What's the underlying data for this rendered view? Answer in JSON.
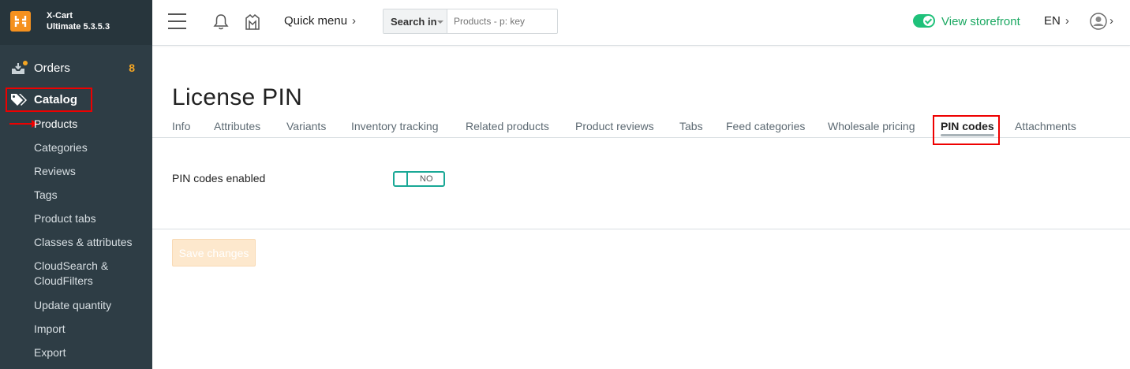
{
  "brand": {
    "name_line1": "X-Cart",
    "name_line2": "Ultimate 5.3.5.3"
  },
  "sidebar": {
    "orders": {
      "label": "Orders",
      "count": "8"
    },
    "catalog": {
      "label": "Catalog"
    },
    "catalog_items": [
      {
        "label": "Products"
      },
      {
        "label": "Categories"
      },
      {
        "label": "Reviews"
      },
      {
        "label": "Tags"
      },
      {
        "label": "Product tabs"
      },
      {
        "label": "Classes & attributes"
      },
      {
        "label": "CloudSearch &"
      },
      {
        "label": "CloudFilters"
      },
      {
        "label": "Update quantity"
      },
      {
        "label": "Import"
      },
      {
        "label": "Export"
      }
    ]
  },
  "header": {
    "quick_menu": "Quick menu",
    "chevron": "›",
    "search_in_label": "Search in",
    "search_placeholder": "Products - p: key",
    "view_storefront": "View storefront",
    "language": "EN"
  },
  "page": {
    "title": "License PIN",
    "tabs": [
      {
        "label": "Info"
      },
      {
        "label": "Attributes"
      },
      {
        "label": "Variants"
      },
      {
        "label": "Inventory tracking"
      },
      {
        "label": "Related products"
      },
      {
        "label": "Product reviews"
      },
      {
        "label": "Tabs"
      },
      {
        "label": "Feed categories"
      },
      {
        "label": "Wholesale pricing"
      },
      {
        "label": "PIN codes"
      },
      {
        "label": "Attachments"
      }
    ],
    "active_tab": "PIN codes",
    "pin_codes_enabled_label": "PIN codes enabled",
    "pin_codes_enabled_value": "NO",
    "save_button": "Save changes"
  },
  "colors": {
    "sidebar_bg": "#2e3d45",
    "accent_orange": "#f5911e",
    "storefront_green": "#1aa861",
    "toggle_teal": "#1aa896",
    "highlight_red": "#ee0000"
  },
  "icons": {
    "logo": "xcart-logo-icon",
    "orders": "orders-icon",
    "catalog": "tags-icon",
    "hamburger": "menu-icon",
    "bell": "bell-icon",
    "marketplace": "marketplace-icon",
    "user": "user-avatar-icon"
  }
}
